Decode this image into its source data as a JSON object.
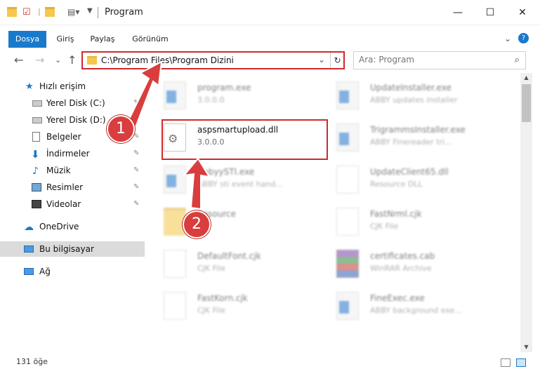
{
  "window": {
    "title": "Program",
    "minimize_glyph": "—",
    "maximize_glyph": "☐",
    "close_glyph": "✕"
  },
  "ribbon": {
    "tabs": [
      "Dosya",
      "Giriş",
      "Paylaş",
      "Görünüm"
    ],
    "expand_glyph": "⌄",
    "help_glyph": "?"
  },
  "address": {
    "path": "C:\\Program Files\\Program Dizini",
    "dropdown_glyph": "⌄",
    "refresh_glyph": "↻"
  },
  "search": {
    "placeholder": "Ara: Program"
  },
  "nav": {
    "back": "←",
    "forward": "→",
    "recent": "⌄",
    "up": "↑"
  },
  "sidebar": {
    "items": [
      {
        "label": "Hızlı erişim",
        "icon": "star-icon",
        "pinned": false
      },
      {
        "label": "Yerel Disk (C:)",
        "icon": "drive-icon",
        "pinned": true
      },
      {
        "label": "Yerel Disk (D:)",
        "icon": "drive-icon",
        "pinned": true
      },
      {
        "label": "Belgeler",
        "icon": "document-icon",
        "pinned": true
      },
      {
        "label": "İndirmeler",
        "icon": "download-icon",
        "pinned": true
      },
      {
        "label": "Müzik",
        "icon": "music-icon",
        "pinned": true
      },
      {
        "label": "Resimler",
        "icon": "picture-icon",
        "pinned": true
      },
      {
        "label": "Videolar",
        "icon": "video-icon",
        "pinned": true
      },
      {
        "label": "OneDrive",
        "icon": "cloud-icon",
        "pinned": false
      },
      {
        "label": "Bu bilgisayar",
        "icon": "computer-icon",
        "pinned": false
      },
      {
        "label": "Ağ",
        "icon": "network-icon",
        "pinned": false
      }
    ],
    "pin_glyph": "📌"
  },
  "files": [
    {
      "name": "program.exe",
      "sub": "3.0.0.0",
      "icon": "installer-icon"
    },
    {
      "name": "UpdateInstaller.exe",
      "sub": "ABBY updates installer",
      "icon": "exe-icon"
    },
    {
      "name": "aspsmartupload.dll",
      "sub": "3.0.0.0",
      "icon": "dll-gear-icon"
    },
    {
      "name": "TrigrammsInstaller.exe",
      "sub": "ABBY Finereader tri...",
      "icon": "exe-icon"
    },
    {
      "name": "AbbyySTI.exe",
      "sub": "ABBY sti event hand...",
      "icon": "exe-icon"
    },
    {
      "name": "UpdateClient65.dll",
      "sub": "Resource DLL",
      "icon": "dll-gear-icon"
    },
    {
      "name": "Resource",
      "sub": "",
      "icon": "folder-icon"
    },
    {
      "name": "FastNrml.cjk",
      "sub": "CJK File",
      "icon": "document-icon"
    },
    {
      "name": "DefaultFont.cjk",
      "sub": "CJK File",
      "icon": "document-icon"
    },
    {
      "name": "certificates.cab",
      "sub": "WinRAR Archive",
      "icon": "archive-icon"
    },
    {
      "name": "FastKorn.cjk",
      "sub": "CJK File",
      "icon": "document-icon"
    },
    {
      "name": "FineExec.exe",
      "sub": "ABBY background exe...",
      "icon": "exe-icon"
    }
  ],
  "status": {
    "count": "131 öğe"
  },
  "callouts": [
    "1",
    "2"
  ],
  "colors": {
    "accent": "#1979ca",
    "highlight": "#cf2a2a",
    "callout": "#d93d3d"
  }
}
